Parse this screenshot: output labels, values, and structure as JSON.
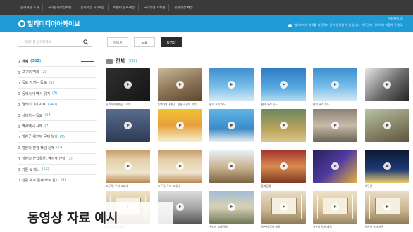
{
  "topnav": [
    "문화재청 소개",
    "국가문화유산포털",
    "문화유산 지식e음",
    "어린이 문화재청",
    "국가유산 기록원",
    "문화유산 채널"
  ],
  "header": {
    "brand": "멀티미디어아카이브",
    "top_right": "문화재청 홈",
    "notice": "멀티미디어 자료를 다운로드 및 이용하실 수 있습니다. 저작권에 유의하여 이용해 주세요."
  },
  "search": {
    "placeholder": "검색어를 입력하세요"
  },
  "categories": [
    {
      "label": "전체",
      "count": "(332)"
    },
    {
      "label": "고구려 벽화",
      "count": "(2)"
    },
    {
      "label": "독도 지키는 독도",
      "count": "(3)"
    },
    {
      "label": "동아시아 역사 읽기",
      "count": "(8)"
    },
    {
      "label": "멀티미디어 자료",
      "count": "(240)"
    },
    {
      "label": "사라지는 독도",
      "count": "(34)"
    },
    {
      "label": "역사왜곡 사례",
      "count": "(7)"
    },
    {
      "label": "일본군 위안부 문제 알기",
      "count": "(7)"
    },
    {
      "label": "일본의 전쟁 책임 문제",
      "count": "(14)"
    },
    {
      "label": "일본의 산업유산, 역사적 진실",
      "count": "(3)"
    },
    {
      "label": "카툰 & 애니",
      "count": "(12)"
    },
    {
      "label": "한중 역사 문제 바로 알기",
      "count": "(6)"
    }
  ],
  "tabs": [
    "이미지",
    "도표",
    "동영상"
  ],
  "active_tab": 2,
  "section": {
    "title": "전체",
    "count": "(332)"
  },
  "grid_captions": [
    "동북아역사재단 - 소개",
    "동북아역사재단 - 짧은 시간의 기억",
    "편의 우리 독도",
    "편의 우리 독도",
    "편의 우리 독도",
    "",
    "",
    "",
    "",
    "",
    "",
    "",
    "고구려, 우리 고대사",
    "고구려, 우리 고대사",
    "",
    "동북공정",
    "",
    "백두산",
    "일본의 역사 왜곡",
    "",
    "우리의 고대 역사",
    "일본의 역사 왜곡",
    "일본의 역사 왜곡",
    "일본의 역사 왜곡"
  ],
  "overlay_caption": "동영상 자료 예시"
}
